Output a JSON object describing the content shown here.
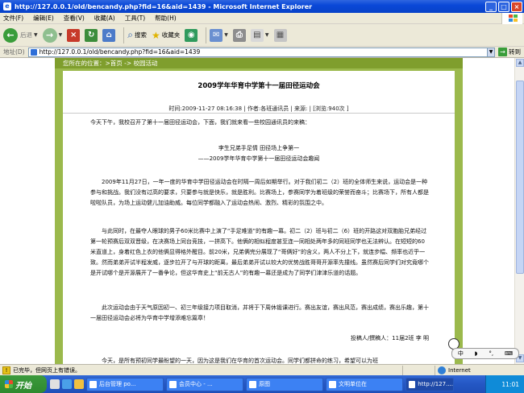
{
  "window": {
    "title": "http://127.0.0.1/old/bencandy.php?fid=16&aid=1439 - Microsoft Internet Explorer",
    "controls": [
      "_",
      "□",
      "×"
    ]
  },
  "menu": {
    "items": [
      "文件(F)",
      "编辑(E)",
      "查看(V)",
      "收藏(A)",
      "工具(T)",
      "帮助(H)"
    ]
  },
  "toolbar": {
    "back_label": "后退",
    "search_label": "搜索",
    "favorites_label": "收藏夹"
  },
  "address": {
    "label": "地址(D)",
    "url": "http://127.0.0.1/old/bencandy.php?fid=16&aid=1439",
    "go_label": "转到"
  },
  "page": {
    "breadcrumb": "您所在的位置：>首页 -> 校园活动",
    "article": {
      "title": "2009学年华育中学第十一届田径运动会",
      "meta": "时间:2009-11-27 08:16:38  |  作者:各班通讯员  |  来源:  |  [浏览:940次 ]",
      "intro": "今天下午，我校召开了第十一届田径运动会，下面，我们就来看一些校园通讯员的来稿：",
      "sub_title": "李生兄弟手足情  田径场上争第一",
      "sub_title2": "——2009学年华育中学第十一届田径运动会趣闻",
      "paragraphs": [
        "2009年11月27日，一年一度的华育中学田径运动会在时隔一周后如期举行。对于我们初二（2）班的全体师生来说，运动会是一种参与和挑战。我们没有过高的要求，只要参与就是快乐，就是胜利。比赛场上，参赛同学为着班级的荣誉而奋斗；比赛场下，所有人都是啦啦队员，为场上运动健儿加油助威。每位同学都融入了运动会热闹、激烈、精彩的氛围之中。",
        "与此同时，在最夺人眼球的男子60米比赛中上演了“手足难道”的有趣一幕。初二（2）班与初二（6）班的开路这对双胞胎兄弟经过第一轮预赛后双双晋级，在决赛场上同台竞技，一拼高下。他俩的相似程度甚至连一同相处两年多的同班同学也无法辨认。在短短的60米直道上，身着红色上衣的他俩显得格外醒目。前20米，兄弟俩完分展现了“哥俩好”的含义，两人不分上下，就连步幅、频率也近乎一致。然而弟弟开试半程发威，逐步拉开了与开球的距离，最后弟弟开试以较大的优势战胜哥哥开源率先撞线。虽然赛后同学们对究竟哪个是开试哪个是开源展开了一番争论，但这华育史上“前无古人”的有趣一幕还是成为了同学们津津乐道的话题。",
        "此次运动会由于天气原因初一、初三年级接力项目取消，并将于下周休锻课进行。赛出友谊，赛出风范，赛出成绩，赛出乐趣，第十一届田径运动会必将为华育中学增添难忘篇章！"
      ],
      "signature": "投稿人/撰稿人：11届2班  李  明",
      "next_line": "今天，是所有预初同学最盼望的一天，因为这是我们在华育的首次运动会。同学们都拼命的练习，希望可以为班"
    }
  },
  "status": {
    "message": "已完毕，但网页上有错误。",
    "zone": "Internet"
  },
  "ime": {
    "items": [
      "中",
      "◗",
      "°,",
      "⌨"
    ]
  },
  "taskbar": {
    "start_label": "开始",
    "tasks": [
      "后台管理  po...",
      "会员中心 - ...",
      "原图",
      "文明单位在",
      "http://127...."
    ],
    "time": "11:01"
  },
  "colors": {
    "site_green": "#9bb94c",
    "site_dark_green": "#7f9e2d",
    "title_blue": "#0a48d8"
  }
}
